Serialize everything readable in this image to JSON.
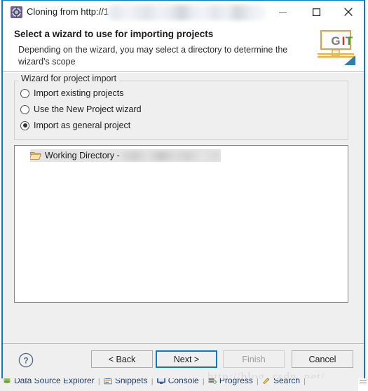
{
  "window": {
    "title": "Cloning from http://1",
    "app_icon": "eclipse-gear-icon",
    "accent_color": "#0d7ac4",
    "controls": {
      "minimize": "minimize-icon",
      "maximize": "maximize-icon",
      "close": "close-icon"
    }
  },
  "header": {
    "title": "Select a wizard to use for importing projects",
    "description": "Depending on the wizard, you may select a directory to determine the wizard's scope",
    "logo": {
      "name": "git-logo",
      "letters": [
        "G",
        "I",
        "T"
      ],
      "colors": [
        "#7a7a7a",
        "#c8392b",
        "#3e9b3e"
      ]
    }
  },
  "group": {
    "label": "Wizard for project import",
    "options": [
      {
        "label": "Import existing projects",
        "selected": false
      },
      {
        "label": "Use the New Project wizard",
        "selected": false
      },
      {
        "label": "Import as general project",
        "selected": true
      }
    ]
  },
  "tree": {
    "item": {
      "icon": "open-folder-icon",
      "label": "Working Directory -",
      "path": "",
      "selected": true
    }
  },
  "buttons": {
    "help": "?",
    "back": "< Back",
    "next": "Next >",
    "finish": "Finish",
    "cancel": "Cancel"
  },
  "watermark": "http://blog. csdn. net/",
  "status_strip": {
    "tabs": [
      {
        "label": "Data Source Explorer",
        "icon": "database-icon"
      },
      {
        "label": "Snippets",
        "icon": "snippets-icon"
      },
      {
        "label": "Console",
        "icon": "console-icon"
      },
      {
        "label": "Progress",
        "icon": "progress-icon"
      },
      {
        "label": "Search",
        "icon": "search-icon"
      }
    ],
    "separator": "|"
  }
}
